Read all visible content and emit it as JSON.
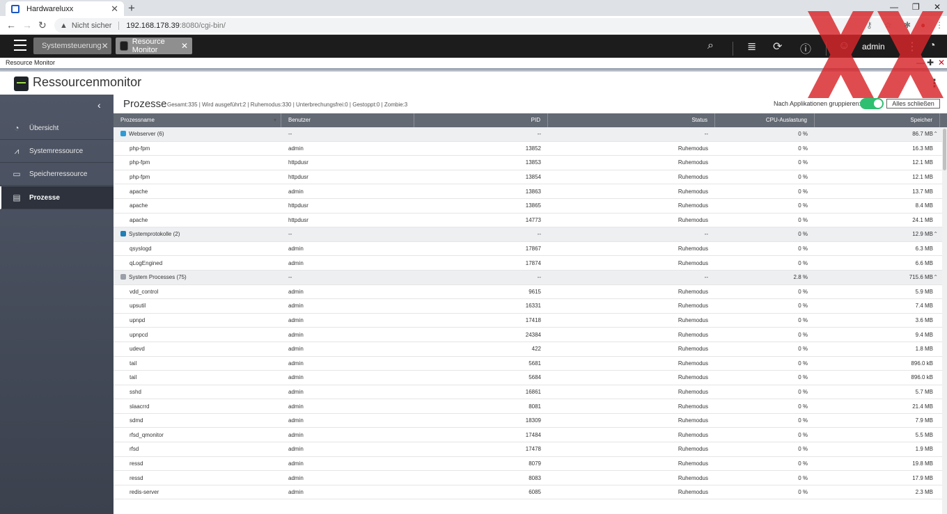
{
  "browser": {
    "tab_title": "Hardwareluxx",
    "new_tab": "+",
    "security": "Nicht sicher",
    "url_host": "192.168.178.39",
    "url_path": ":8080/cgi-bin/"
  },
  "topbar": {
    "tabs": [
      {
        "label": "Systemsteuerung"
      },
      {
        "label": "Resource Monitor"
      }
    ],
    "user": "admin"
  },
  "window_title": "Resource Monitor",
  "app": {
    "title": "Ressourcenmonitor"
  },
  "sidebar": {
    "items": [
      {
        "label": "Übersicht"
      },
      {
        "label": "Systemressource"
      },
      {
        "label": "Speicherressource"
      },
      {
        "label": "Prozesse"
      }
    ]
  },
  "processes": {
    "title": "Prozesse",
    "stats": "Gesamt:335 | Wird ausgeführt:2 | Ruhemodus:330 | Unterbrechungsfrei:0 | Gestoppt:0 | Zombie:3",
    "group_label": "Nach Applikationen gruppieren:",
    "close_all": "Alles schließen",
    "columns": [
      "Prozessname",
      "Benutzer",
      "PID",
      "Status",
      "CPU-Auslastung",
      "Speicher"
    ],
    "rows": [
      {
        "group": true,
        "icon": "#2e9bd6",
        "name": "Webserver (6)",
        "user": "--",
        "pid": "--",
        "status": "--",
        "cpu": "0 %",
        "mem": "86.7 MB"
      },
      {
        "name": "php-fpm",
        "user": "admin",
        "pid": "13852",
        "status": "Ruhemodus",
        "cpu": "0 %",
        "mem": "16.3 MB"
      },
      {
        "name": "php-fpm",
        "user": "httpdusr",
        "pid": "13853",
        "status": "Ruhemodus",
        "cpu": "0 %",
        "mem": "12.1 MB"
      },
      {
        "name": "php-fpm",
        "user": "httpdusr",
        "pid": "13854",
        "status": "Ruhemodus",
        "cpu": "0 %",
        "mem": "12.1 MB"
      },
      {
        "name": "apache",
        "user": "admin",
        "pid": "13863",
        "status": "Ruhemodus",
        "cpu": "0 %",
        "mem": "13.7 MB"
      },
      {
        "name": "apache",
        "user": "httpdusr",
        "pid": "13865",
        "status": "Ruhemodus",
        "cpu": "0 %",
        "mem": "8.4 MB"
      },
      {
        "name": "apache",
        "user": "httpdusr",
        "pid": "14773",
        "status": "Ruhemodus",
        "cpu": "0 %",
        "mem": "24.1 MB"
      },
      {
        "group": true,
        "icon": "#1f7fb8",
        "name": "Systemprotokolle (2)",
        "user": "--",
        "pid": "--",
        "status": "--",
        "cpu": "0 %",
        "mem": "12.9 MB"
      },
      {
        "name": "qsyslogd",
        "user": "admin",
        "pid": "17867",
        "status": "Ruhemodus",
        "cpu": "0 %",
        "mem": "6.3 MB"
      },
      {
        "name": "qLogEngined",
        "user": "admin",
        "pid": "17874",
        "status": "Ruhemodus",
        "cpu": "0 %",
        "mem": "6.6 MB"
      },
      {
        "group": true,
        "icon": "#9aa0a8",
        "name": "System Processes (75)",
        "user": "--",
        "pid": "--",
        "status": "--",
        "cpu": "2.8 %",
        "mem": "715.6 MB"
      },
      {
        "name": "vdd_control",
        "user": "admin",
        "pid": "9615",
        "status": "Ruhemodus",
        "cpu": "0 %",
        "mem": "5.9 MB"
      },
      {
        "name": "upsutil",
        "user": "admin",
        "pid": "16331",
        "status": "Ruhemodus",
        "cpu": "0 %",
        "mem": "7.4 MB"
      },
      {
        "name": "upnpd",
        "user": "admin",
        "pid": "17418",
        "status": "Ruhemodus",
        "cpu": "0 %",
        "mem": "3.6 MB"
      },
      {
        "name": "upnpcd",
        "user": "admin",
        "pid": "24384",
        "status": "Ruhemodus",
        "cpu": "0 %",
        "mem": "9.4 MB"
      },
      {
        "name": "udevd",
        "user": "admin",
        "pid": "422",
        "status": "Ruhemodus",
        "cpu": "0 %",
        "mem": "1.8 MB"
      },
      {
        "name": "tail",
        "user": "admin",
        "pid": "5681",
        "status": "Ruhemodus",
        "cpu": "0 %",
        "mem": "896.0 kB"
      },
      {
        "name": "tail",
        "user": "admin",
        "pid": "5684",
        "status": "Ruhemodus",
        "cpu": "0 %",
        "mem": "896.0 kB"
      },
      {
        "name": "sshd",
        "user": "admin",
        "pid": "16861",
        "status": "Ruhemodus",
        "cpu": "0 %",
        "mem": "5.7 MB"
      },
      {
        "name": "slaacrrd",
        "user": "admin",
        "pid": "8081",
        "status": "Ruhemodus",
        "cpu": "0 %",
        "mem": "21.4 MB"
      },
      {
        "name": "sdmd",
        "user": "admin",
        "pid": "18309",
        "status": "Ruhemodus",
        "cpu": "0 %",
        "mem": "7.9 MB"
      },
      {
        "name": "rfsd_qmonitor",
        "user": "admin",
        "pid": "17484",
        "status": "Ruhemodus",
        "cpu": "0 %",
        "mem": "5.5 MB"
      },
      {
        "name": "rfsd",
        "user": "admin",
        "pid": "17478",
        "status": "Ruhemodus",
        "cpu": "0 %",
        "mem": "1.9 MB"
      },
      {
        "name": "ressd",
        "user": "admin",
        "pid": "8079",
        "status": "Ruhemodus",
        "cpu": "0 %",
        "mem": "19.8 MB"
      },
      {
        "name": "ressd",
        "user": "admin",
        "pid": "8083",
        "status": "Ruhemodus",
        "cpu": "0 %",
        "mem": "17.9 MB"
      },
      {
        "name": "redis-server",
        "user": "admin",
        "pid": "6085",
        "status": "Ruhemodus",
        "cpu": "0 %",
        "mem": "2.3 MB"
      }
    ]
  },
  "colors": {
    "accent": "#2fbf71",
    "close": "#d0021b",
    "sidebar": "#464c59"
  }
}
